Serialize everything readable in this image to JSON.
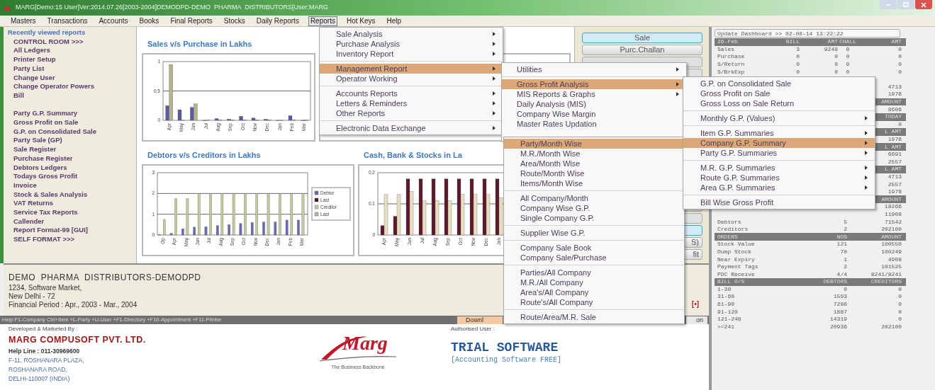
{
  "window": {
    "title": "MARG[Demo:15 User]Ver:2014.07.26[2003-2004]DEMODPD-DEMO  PHARMA  DISTRIBUTORS[User:MARG"
  },
  "menu_bar": [
    {
      "label": "Masters",
      "selected": false
    },
    {
      "label": "Transactions",
      "selected": false
    },
    {
      "label": "Accounts",
      "selected": false
    },
    {
      "label": "Books",
      "selected": false
    },
    {
      "label": "Final Reports",
      "selected": false
    },
    {
      "label": "Stocks",
      "selected": false
    },
    {
      "label": "Daily Reports",
      "selected": false
    },
    {
      "label": "Reports",
      "selected": true
    },
    {
      "label": "Hot Keys",
      "selected": false
    },
    {
      "label": "Help",
      "selected": false
    }
  ],
  "sidebar": {
    "heading": "Recently viewed reports",
    "groups": [
      [
        "CONTROL ROOM >>>",
        "All Ledgers",
        "Printer Setup",
        "Party List",
        "Change User",
        "Change Operator Powers",
        "Bill"
      ],
      [
        "Party G.P. Summary",
        "Gross Profit on Sale",
        "G.P. on Consolidated Sale",
        "Party Sale (GP)",
        "Sale Register",
        "Purchase Register",
        "Debtors Ledgers",
        "Todays Gross Profit",
        "Invoice",
        "Stock & Sales Analysis",
        "VAT Returns",
        "Service Tax Reports",
        "Callender",
        "Report Format-99 [GUI]",
        "SELF FORMAT >>>"
      ]
    ]
  },
  "charts": [
    {
      "title": "Sales v/s Purchase in Lakhs",
      "chart_data": {
        "type": "bar",
        "categories": [
          "Apr",
          "May",
          "Jun",
          "Jul",
          "Aug",
          "Sep",
          "Oct",
          "Nov",
          "Dec",
          "Jan",
          "Feb",
          "Mar"
        ],
        "ylim": [
          0,
          1
        ],
        "yticks": [
          0,
          0.5,
          1
        ],
        "series": [
          {
            "color": "#5a5aa0",
            "values": [
              0.25,
              0.18,
              0.22,
              0,
              0.03,
              0.02,
              0.07,
              0.04,
              0.02,
              0,
              0.08,
              0
            ]
          },
          {
            "color": "#b4b48c",
            "values": [
              0.95,
              0,
              0.28,
              0.01,
              0.01,
              0.01,
              0.01,
              0.01,
              0.01,
              0,
              0.01,
              0.01
            ]
          }
        ]
      }
    },
    {
      "title": "Debtors v/s Creditors in Lakhs",
      "chart_data": {
        "type": "bar",
        "legend": "right",
        "categories": [
          "Op",
          "Apr",
          "May",
          "Jun",
          "Jul",
          "Aug",
          "Sep",
          "Oct",
          "Nov",
          "Dec",
          "Jan",
          "Feb",
          "Mar"
        ],
        "ylim": [
          0,
          3
        ],
        "yticks": [
          0,
          1,
          2,
          3
        ],
        "series": [
          {
            "name": "Debtor",
            "color": "#6a6ab4",
            "values": [
              0.02,
              0.08,
              0.3,
              0.38,
              0.4,
              0.45,
              0.5,
              0.55,
              0.6,
              0.62,
              0.62,
              0.72,
              0.72
            ]
          },
          {
            "name": "Last",
            "color": "#4a1a2a",
            "values": [
              null,
              null,
              null,
              null,
              null,
              null,
              null,
              null,
              null,
              null,
              null,
              null,
              null
            ]
          },
          {
            "name": "Creditor",
            "color": "#c8c8a0",
            "values": [
              0.75,
              1.75,
              1.75,
              2,
              2,
              2,
              2,
              2,
              2,
              2,
              2,
              2,
              2
            ]
          },
          {
            "name": "Last",
            "color": "#a8b8b8",
            "values": [
              null,
              null,
              null,
              null,
              null,
              null,
              null,
              null,
              null,
              null,
              null,
              null,
              null
            ]
          }
        ]
      }
    },
    {
      "title": "Cash, Bank & Stocks in La",
      "chart_data": {
        "type": "bar",
        "categories": [
          "Apr",
          "May",
          "Jun",
          "Jul",
          "Aug",
          "Sep",
          "Oct",
          "Nov",
          "Dec",
          "Jan"
        ],
        "ylim": [
          0,
          0.2
        ],
        "yticks": [
          0,
          0.1,
          0.2
        ],
        "series": [
          {
            "color": "#5a1a2a",
            "values": [
              0.03,
              0.06,
              0.18,
              0.18,
              0.18,
              0.18,
              0.18,
              0.18,
              0.18,
              0.18
            ]
          },
          {
            "color": "#eadcc0",
            "values": [
              0.13,
              0.13,
              0.14,
              0.11,
              0.11,
              0.11,
              0.13,
              0.13,
              0.13,
              0.12
            ]
          }
        ]
      }
    }
  ],
  "side_buttons_top": [
    {
      "label": "Sale",
      "selected": true
    },
    {
      "label": "Purc.Challan",
      "selected": false
    }
  ],
  "side_buttons_bottom": [
    {
      "selected": true
    },
    {
      "label": "S)",
      "selected": false
    },
    {
      "label": "fit",
      "selected": false
    }
  ],
  "company": {
    "name": "DEMO  PHARMA  DISTRIBUTORS-DEMODPD",
    "lines": [
      "1234, Software Market,",
      "New Delhi - 72",
      "Financial Period : Apr., 2003 - Mar., 2004"
    ],
    "marker": "[•]"
  },
  "help_bar": {
    "text": "Help:F1-Company Ctrl+Item +L-Party +U-User +F1-Directory +F10-Appointment +F11-Printer",
    "buttons": [
      "Downl",
      "on"
    ]
  },
  "footer": {
    "developer_caption": "Developed & Marketed By :",
    "developer": "MARG COMPUSOFT PVT. LTD.",
    "helpline": "Help Line : 011-30969600",
    "address": [
      "F-11, ROSHANARA PLAZA,",
      "ROSHANARA ROAD,",
      "DELHI-110007 (INDIA)"
    ],
    "logo_text": "Marg",
    "tagline": "The Business Backbone",
    "user_caption": "Authorised User :",
    "user": "TRIAL SOFTWARE",
    "user_note": "[Accounting Software FREE]"
  },
  "dashboard": {
    "update_button": "Update Dashboard >> 02-08-14 13:22:22",
    "summary_rows": [
      {
        "kind": "header",
        "col_1": "26-Feb",
        "col_2": "BILL",
        "col_3": "AMT",
        "col_4": "CHALL",
        "col_5": "AMT"
      },
      {
        "kind": "data",
        "col_1": "Sales",
        "col_2": "3",
        "col_3": "9248",
        "col_4": "0",
        "col_5": "0"
      },
      {
        "kind": "data",
        "col_1": "Purchase",
        "col_2": "0",
        "col_3": "0",
        "col_4": "0",
        "col_5": "0"
      },
      {
        "kind": "data",
        "col_1": "S/Return",
        "col_2": "0",
        "col_3": "0",
        "col_4": "0",
        "col_5": "0"
      },
      {
        "kind": "data",
        "col_1": "S/BrkExp",
        "col_2": "0",
        "col_3": "0",
        "col_4": "0",
        "col_5": "0"
      },
      {
        "kind": "data"
      },
      {
        "kind": "data",
        "col_5": "4713"
      },
      {
        "kind": "data",
        "col_5": "1978"
      }
    ],
    "detail_rows": [
      {
        "kind": "header",
        "col_3": "AMOUNT"
      },
      {
        "kind": "data",
        "col_3": "8606"
      },
      {
        "kind": "header",
        "col_3": "TODAY"
      },
      {
        "kind": "data",
        "col_3": "0"
      },
      {
        "kind": "header",
        "col_3": "L AMT"
      },
      {
        "kind": "data",
        "col_3": "1978"
      },
      {
        "kind": "header",
        "col_3": "L AMT"
      },
      {
        "kind": "data",
        "col_3": "6691"
      },
      {
        "kind": "data",
        "col_3": "2557"
      },
      {
        "kind": "header",
        "col_3": "L AMT"
      },
      {
        "kind": "data",
        "col_3": "4713"
      },
      {
        "kind": "data",
        "col_3": "2557"
      },
      {
        "kind": "data",
        "col_3": "1978"
      },
      {
        "kind": "header",
        "col_3": "AMOUNT"
      },
      {
        "kind": "data",
        "col_3": "18266"
      },
      {
        "kind": "data",
        "col_3": "11908"
      },
      {
        "kind": "data",
        "col_1": "Debtors",
        "col_2": "5",
        "col_3": "71542"
      },
      {
        "kind": "data",
        "col_1": "Creditors",
        "col_2": "2",
        "col_3": "202100"
      },
      {
        "kind": "header",
        "col_1": "ORDERS",
        "col_2": "NOS",
        "col_3": "AMOUNT"
      },
      {
        "kind": "data",
        "col_1": "Stock Value",
        "col_2": "121",
        "col_3": "100550"
      },
      {
        "kind": "data",
        "col_1": "Dump Stock",
        "col_2": "70",
        "col_3": "100249"
      },
      {
        "kind": "data",
        "col_1": "Near Expiry",
        "col_2": "1",
        "col_3": "4908"
      },
      {
        "kind": "data",
        "col_1": "Payment Tags",
        "col_2": "2",
        "col_3": "101525"
      },
      {
        "kind": "data",
        "col_1": "PDC Receive",
        "col_2": "4/4",
        "col_3": "8241/8241"
      },
      {
        "kind": "header",
        "col_1": "BILL O/S",
        "col_2": "DEBTORS",
        "col_3": "CREDITORS"
      },
      {
        "kind": "data",
        "col_1": "1-30",
        "col_2": "0",
        "col_3": "0"
      },
      {
        "kind": "data",
        "col_1": "31-60",
        "col_2": "1593",
        "col_3": "0"
      },
      {
        "kind": "data",
        "col_1": "61-90",
        "col_2": "7298",
        "col_3": "0"
      },
      {
        "kind": "data",
        "col_1": "91-120",
        "col_2": "1887",
        "col_3": "0"
      },
      {
        "kind": "data",
        "col_1": "121-240",
        "col_2": "14319",
        "col_3": "0"
      },
      {
        "kind": "data",
        "col_1": ">=241",
        "col_2": "20936",
        "col_3": "202100"
      }
    ]
  },
  "open_menus": [
    {
      "groups": [
        [
          {
            "label": "Sale Analysis",
            "submenu": true,
            "selected": false
          },
          {
            "label": "Purchase Analysis",
            "submenu": true,
            "selected": false
          },
          {
            "label": "Inventory Report",
            "submenu": true,
            "selected": false
          }
        ],
        [
          {
            "label": "Management Report",
            "submenu": true,
            "selected": true
          },
          {
            "label": "Operator Working",
            "submenu": true,
            "selected": false
          }
        ],
        [
          {
            "label": "Accounts Reports",
            "submenu": true,
            "selected": false
          },
          {
            "label": "Letters & Reminders",
            "submenu": true,
            "selected": false
          },
          {
            "label": "Other Reports",
            "submenu": true,
            "selected": false
          }
        ],
        [
          {
            "label": "Electronic Data Exchange",
            "submenu": true,
            "selected": false
          }
        ]
      ]
    },
    {
      "groups": [
        [
          {
            "label": "Utilities",
            "submenu": true,
            "selected": false
          }
        ],
        [
          {
            "label": "Gross Profit Analysis",
            "submenu": true,
            "selected": true
          },
          {
            "label": "MIS Reports & Graphs",
            "submenu": true,
            "selected": false
          },
          {
            "label": "Daily Analysis (MIS)",
            "submenu": false,
            "selected": false
          },
          {
            "label": "Company Wise Margin",
            "submenu": false,
            "selected": false
          },
          {
            "label": "Master Rates Updation",
            "submenu": false,
            "selected": false
          }
        ]
      ]
    },
    {
      "groups": [
        [
          {
            "label": "Party/Month Wise",
            "submenu": false,
            "selected": true
          },
          {
            "label": "M.R./Month Wise",
            "submenu": false,
            "selected": false
          },
          {
            "label": "Area/Month Wise",
            "submenu": false,
            "selected": false
          },
          {
            "label": "Route/Month Wise",
            "submenu": false,
            "selected": false
          },
          {
            "label": "Items/Month Wise",
            "submenu": false,
            "selected": false
          }
        ],
        [
          {
            "label": "All Company/Month",
            "submenu": false,
            "selected": false
          },
          {
            "label": "Company Wise G.P.",
            "submenu": false,
            "selected": false
          },
          {
            "label": "Single Company G.P.",
            "submenu": false,
            "selected": false
          }
        ],
        [
          {
            "label": "Supplier Wise G.P.",
            "submenu": false,
            "selected": false
          }
        ],
        [
          {
            "label": "Company Sale Book",
            "submenu": false,
            "selected": false
          },
          {
            "label": "Company Sale/Purchase",
            "submenu": false,
            "selected": false
          }
        ],
        [
          {
            "label": "Parties/All Company",
            "submenu": false,
            "selected": false
          },
          {
            "label": "M.R./All Company",
            "submenu": false,
            "selected": false
          },
          {
            "label": "Area's/All Company",
            "submenu": false,
            "selected": false
          },
          {
            "label": "Route's/All Company",
            "submenu": false,
            "selected": false
          }
        ],
        [
          {
            "label": "Route/Area/M.R. Sale",
            "submenu": false,
            "selected": false
          }
        ]
      ]
    },
    {
      "groups": [
        [
          {
            "label": "G.P. on Consolidated Sale",
            "submenu": false,
            "selected": false
          },
          {
            "label": "Gross Profit on Sale",
            "submenu": false,
            "selected": false
          },
          {
            "label": "Gross Loss on Sale Return",
            "submenu": false,
            "selected": false
          }
        ],
        [
          {
            "label": "Monthly G.P. (Values)",
            "submenu": true,
            "selected": false
          }
        ],
        [
          {
            "label": "Item G.P. Summaries",
            "submenu": true,
            "selected": false
          },
          {
            "label": "Company G.P. Summary",
            "submenu": true,
            "selected": true
          },
          {
            "label": "Party G.P. Summaries",
            "submenu": true,
            "selected": false
          }
        ],
        [
          {
            "label": "M.R. G.P. Summaries",
            "submenu": true,
            "selected": false
          },
          {
            "label": "Route G.P. Summaries",
            "submenu": true,
            "selected": false
          },
          {
            "label": "Area G.P. Summaries",
            "submenu": true,
            "selected": false
          }
        ],
        [
          {
            "label": "Bill Wise Gross Profit",
            "submenu": false,
            "selected": false
          }
        ]
      ]
    }
  ]
}
